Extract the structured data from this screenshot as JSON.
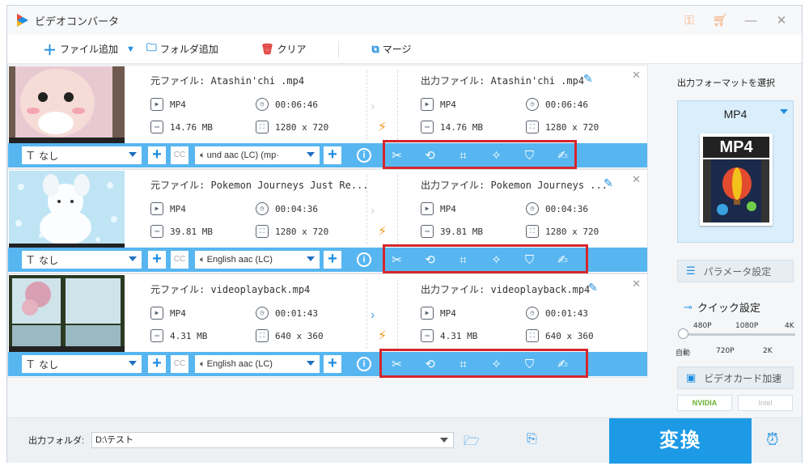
{
  "app": {
    "title": "ビデオコンバータ"
  },
  "toolbar": {
    "add_file": "ファイル追加",
    "add_folder": "フォルダ追加",
    "clear": "クリア",
    "merge": "マージ"
  },
  "items": [
    {
      "src_name": "元ファイル: Atashin'chi .mp4",
      "out_name": "出力ファイル: Atashin'chi .mp4",
      "src_format": "MP4",
      "src_duration": "00:06:46",
      "src_size": "14.76 MB",
      "src_res": "1280 x 720",
      "out_format": "MP4",
      "out_duration": "00:06:46",
      "out_size": "14.76 MB",
      "out_res": "1280 x 720",
      "subtitle": "なし",
      "audio": "und aac (LC) (mp·"
    },
    {
      "src_name": "元ファイル: Pokemon Journeys Just Re...",
      "out_name": "出力ファイル: Pokemon Journeys ...",
      "src_format": "MP4",
      "src_duration": "00:04:36",
      "src_size": "39.81 MB",
      "src_res": "1280 x 720",
      "out_format": "MP4",
      "out_duration": "00:04:36",
      "out_size": "39.81 MB",
      "out_res": "1280 x 720",
      "subtitle": "なし",
      "audio": "English aac (LC)"
    },
    {
      "src_name": "元ファイル: videoplayback.mp4",
      "out_name": "出力ファイル: videoplayback.mp4",
      "src_format": "MP4",
      "src_duration": "00:01:43",
      "src_size": "4.31 MB",
      "src_res": "640 x 360",
      "out_format": "MP4",
      "out_duration": "00:01:43",
      "out_size": "4.31 MB",
      "out_res": "640 x 360",
      "subtitle": "なし",
      "audio": "English aac (LC)"
    }
  ],
  "side": {
    "header": "出力フォーマットを選択",
    "format": "MP4",
    "poster_text": "MP4",
    "params": "パラメータ設定",
    "quick": "クイック設定",
    "quality_top": [
      "480P",
      "1080P",
      "4K"
    ],
    "quality_bottom": [
      "自動",
      "720P",
      "2K"
    ],
    "quality_level": 0,
    "gpu_accel": "ビデオカード加速",
    "nvidia": "NVIDIA",
    "intel": "Intel"
  },
  "bottom": {
    "out_label": "出力フォルダ:",
    "out_path": "D:\\テスト",
    "convert": "変換"
  },
  "colors": {
    "accent": "#1d9ae6",
    "bar": "#57b6f0",
    "highlight": "#d5262c",
    "bolt": "#f39a1e"
  }
}
